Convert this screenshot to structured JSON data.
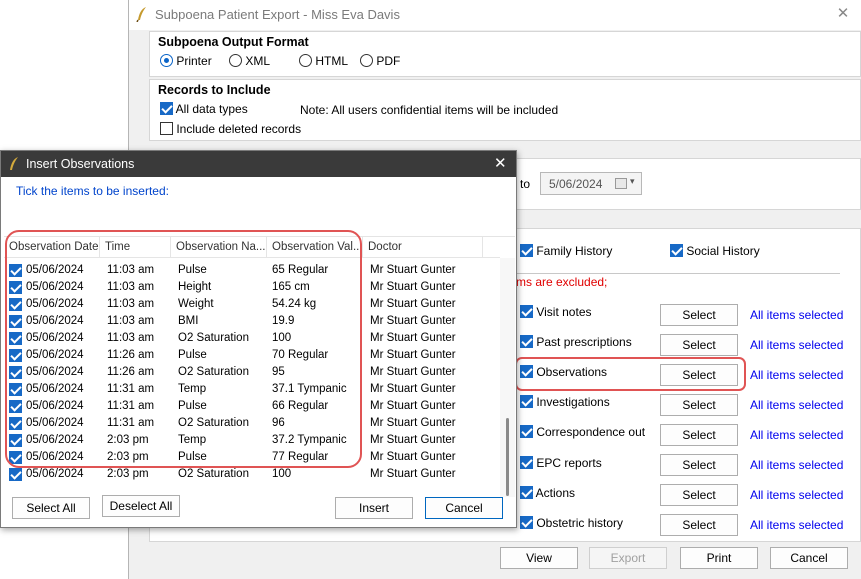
{
  "window": {
    "title": "Subpoena Patient Export - Miss Eva Davis"
  },
  "output_format": {
    "title": "Subpoena Output Format",
    "options": [
      {
        "label": "Printer",
        "selected": true
      },
      {
        "label": "XML",
        "selected": false
      },
      {
        "label": "HTML",
        "selected": false
      },
      {
        "label": "PDF",
        "selected": false
      }
    ]
  },
  "records": {
    "title": "Records to Include",
    "all_types": "All data types",
    "include_deleted": "Include deleted records",
    "note": "Note: All users confidential items will be included"
  },
  "date_range": {
    "to_label": "to",
    "to_date": "5/06/2024"
  },
  "history": {
    "family": "Family History",
    "social": "Social History",
    "excluded_text": "ms are excluded;"
  },
  "categories": [
    {
      "label": "Visit notes",
      "button": "Select",
      "status": "All items selected"
    },
    {
      "label": "Past prescriptions",
      "button": "Select",
      "status": "All items selected"
    },
    {
      "label": "Observations",
      "button": "Select",
      "status": "All items selected"
    },
    {
      "label": "Investigations",
      "button": "Select",
      "status": "All items selected"
    },
    {
      "label": "Correspondence out",
      "button": "Select",
      "status": "All items selected"
    },
    {
      "label": "EPC reports",
      "button": "Select",
      "status": "All items selected"
    },
    {
      "label": "Actions",
      "button": "Select",
      "status": "All items selected"
    },
    {
      "label": "Obstetric history",
      "button": "Select",
      "status": "All items selected"
    }
  ],
  "bottom_buttons": {
    "view": "View",
    "export": "Export",
    "print": "Print",
    "cancel": "Cancel"
  },
  "dialog": {
    "title": "Insert Observations",
    "instruction": "Tick the items to be inserted:",
    "columns": [
      "Observation Date",
      "Time",
      "Observation Na...",
      "Observation Val...",
      "Doctor"
    ],
    "rows": [
      [
        "05/06/2024",
        "11:03 am",
        "Pulse",
        "65 Regular",
        "Mr Stuart Gunter"
      ],
      [
        "05/06/2024",
        "11:03 am",
        "Height",
        "165 cm",
        "Mr Stuart Gunter"
      ],
      [
        "05/06/2024",
        "11:03 am",
        "Weight",
        "54.24 kg",
        "Mr Stuart Gunter"
      ],
      [
        "05/06/2024",
        "11:03 am",
        "BMI",
        "19.9",
        "Mr Stuart Gunter"
      ],
      [
        "05/06/2024",
        "11:03 am",
        "O2 Saturation",
        "100",
        "Mr Stuart Gunter"
      ],
      [
        "05/06/2024",
        "11:26 am",
        "Pulse",
        "70 Regular",
        "Mr Stuart Gunter"
      ],
      [
        "05/06/2024",
        "11:26 am",
        "O2 Saturation",
        "95",
        "Mr Stuart Gunter"
      ],
      [
        "05/06/2024",
        "11:31 am",
        "Temp",
        "37.1 Tympanic",
        "Mr Stuart Gunter"
      ],
      [
        "05/06/2024",
        "11:31 am",
        "Pulse",
        "66 Regular",
        "Mr Stuart Gunter"
      ],
      [
        "05/06/2024",
        "11:31 am",
        "O2 Saturation",
        "96",
        "Mr Stuart Gunter"
      ],
      [
        "05/06/2024",
        "2:03 pm",
        "Temp",
        "37.2 Tympanic",
        "Mr Stuart Gunter"
      ],
      [
        "05/06/2024",
        "2:03 pm",
        "Pulse",
        "77 Regular",
        "Mr Stuart Gunter"
      ],
      [
        "05/06/2024",
        "2:03 pm",
        "O2 Saturation",
        "100",
        "Mr Stuart Gunter"
      ]
    ],
    "select_all": "Select All",
    "deselect_all": "Deselect All",
    "insert": "Insert",
    "cancel": "Cancel"
  }
}
